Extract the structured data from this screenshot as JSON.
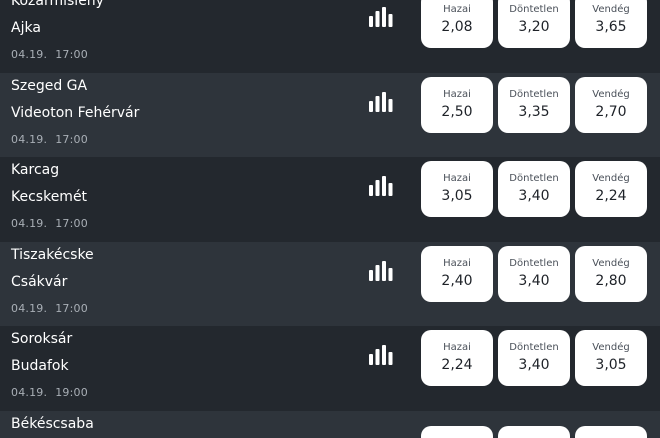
{
  "labels": {
    "home": "Hazai",
    "draw": "Döntetlen",
    "away": "Vendég"
  },
  "matches": [
    {
      "home": "Kozármisleny",
      "away": "Ajka",
      "date": "04.19.",
      "time": "17:00",
      "odds": [
        "2,08",
        "3,20",
        "3,65"
      ]
    },
    {
      "home": "Szeged GA",
      "away": "Videoton Fehérvár",
      "date": "04.19.",
      "time": "17:00",
      "odds": [
        "2,50",
        "3,35",
        "2,70"
      ]
    },
    {
      "home": "Karcag",
      "away": "Kecskemét",
      "date": "04.19.",
      "time": "17:00",
      "odds": [
        "3,05",
        "3,40",
        "2,24"
      ]
    },
    {
      "home": "Tiszakécske",
      "away": "Csákvár",
      "date": "04.19.",
      "time": "17:00",
      "odds": [
        "2,40",
        "3,40",
        "2,80"
      ]
    },
    {
      "home": "Soroksár",
      "away": "Budafok",
      "date": "04.19.",
      "time": "19:00",
      "odds": [
        "2,24",
        "3,40",
        "3,05"
      ]
    },
    {
      "home": "Békéscsaba",
      "away": "",
      "date": "",
      "time": "",
      "odds": [
        "",
        "",
        ""
      ]
    }
  ],
  "icons": {
    "stats": "bar-chart-icon"
  },
  "colors": {
    "row_dark": "#23282e",
    "row_light": "#2e343b",
    "button_bg": "#ffffff",
    "meta_text": "#a9afb6"
  }
}
